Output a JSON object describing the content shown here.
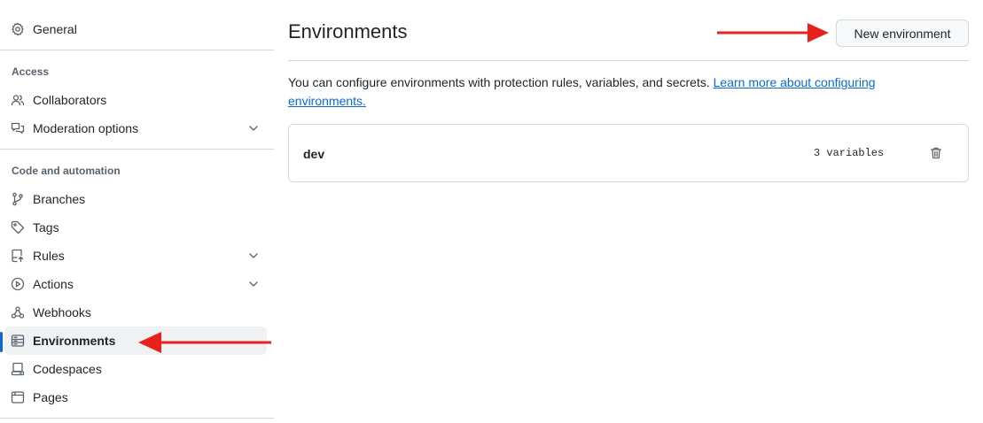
{
  "sidebar": {
    "general": "General",
    "section_access": "Access",
    "collaborators": "Collaborators",
    "moderation": "Moderation options",
    "section_code": "Code and automation",
    "branches": "Branches",
    "tags": "Tags",
    "rules": "Rules",
    "actions": "Actions",
    "webhooks": "Webhooks",
    "environments": "Environments",
    "codespaces": "Codespaces",
    "pages": "Pages"
  },
  "main": {
    "title": "Environments",
    "new_button": "New environment",
    "description": "You can configure environments with protection rules, variables, and secrets.",
    "learn_more": "Learn more about configuring environments.",
    "environments": [
      {
        "name": "dev",
        "variables": "3 variables"
      }
    ]
  },
  "colors": {
    "link": "#0969da",
    "annotation_arrow": "#e8211c",
    "active_item_bg": "#eff1f3",
    "active_indicator": "#0969da"
  },
  "icons": {
    "general": "gear-icon",
    "collaborators": "people-icon",
    "moderation": "comment-discussion-icon",
    "branches": "git-branch-icon",
    "tags": "tag-icon",
    "rules": "repo-push-icon",
    "actions": "play-icon",
    "webhooks": "webhook-icon",
    "environments": "server-icon",
    "codespaces": "codespaces-icon",
    "pages": "browser-icon",
    "delete": "trash-icon"
  }
}
